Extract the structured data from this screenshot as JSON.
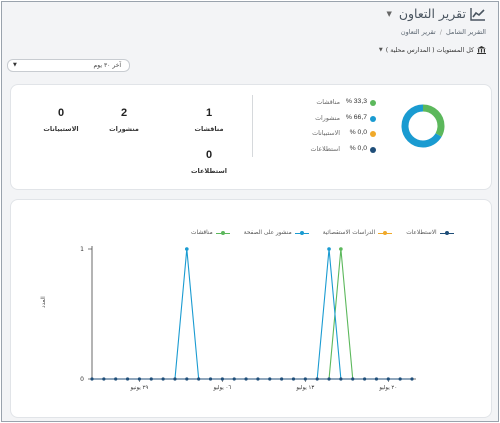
{
  "header": {
    "title": "تقرير التعاون",
    "title_icon": "line-chart-icon",
    "breadcrumb": [
      "التقرير الشامل",
      "تقرير التعاون"
    ]
  },
  "filters": {
    "levels_label": "كل المستويات ( المدارس محلية )",
    "levels_icon": "school-icon",
    "date_range": "آخر ٣٠ يوم"
  },
  "stats": {
    "discussions": {
      "value": "1",
      "label": "مناقشات"
    },
    "posts": {
      "value": "2",
      "label": "منشورات"
    },
    "inquiries": {
      "value": "0",
      "label": "الاستبيانات"
    },
    "polls": {
      "value": "0",
      "label": "استطلاعات"
    }
  },
  "distribution": [
    {
      "name": "مناقشات",
      "pct": "33,3 %",
      "value": 33.3,
      "color": "#5cb85c"
    },
    {
      "name": "منشورات",
      "pct": "66,7 %",
      "value": 66.7,
      "color": "#1a9bd1"
    },
    {
      "name": "الاستبيانات",
      "pct": "0,0 %",
      "value": 0,
      "color": "#f0a92a"
    },
    {
      "name": "استطلاعات",
      "pct": "0,0 %",
      "value": 0,
      "color": "#1f4e79"
    }
  ],
  "chart_data": {
    "type": "line",
    "ylabel": "العدد",
    "ylim": [
      0,
      1
    ],
    "yticks": [
      "0",
      "1"
    ],
    "x_tick_labels": [
      "٢٩ يونيو",
      "٠٦ يوليو",
      "١٣ يوليو",
      "٢٠ يوليو"
    ],
    "x_tick_positions": [
      4,
      11,
      18,
      25
    ],
    "n_points": 28,
    "legend_position": "top",
    "series": [
      {
        "name": "مناقشات",
        "color": "#5cb85c",
        "values": [
          0,
          0,
          0,
          0,
          0,
          0,
          0,
          0,
          0,
          0,
          0,
          0,
          0,
          0,
          0,
          0,
          0,
          0,
          0,
          0,
          0,
          1,
          0,
          0,
          0,
          0,
          0,
          0
        ]
      },
      {
        "name": "منشور على الصفحة",
        "color": "#1a9bd1",
        "values": [
          0,
          0,
          0,
          0,
          0,
          0,
          0,
          0,
          1,
          0,
          0,
          0,
          0,
          0,
          0,
          0,
          0,
          0,
          0,
          0,
          1,
          0,
          0,
          0,
          0,
          0,
          0,
          0
        ]
      },
      {
        "name": "الدراسات الاستقصائية",
        "color": "#f0a92a",
        "values": [
          0,
          0,
          0,
          0,
          0,
          0,
          0,
          0,
          0,
          0,
          0,
          0,
          0,
          0,
          0,
          0,
          0,
          0,
          0,
          0,
          0,
          0,
          0,
          0,
          0,
          0,
          0,
          0
        ]
      },
      {
        "name": "الاستطلاعات",
        "color": "#1f4e79",
        "values": [
          0,
          0,
          0,
          0,
          0,
          0,
          0,
          0,
          0,
          0,
          0,
          0,
          0,
          0,
          0,
          0,
          0,
          0,
          0,
          0,
          0,
          0,
          0,
          0,
          0,
          0,
          0,
          0
        ]
      }
    ]
  }
}
